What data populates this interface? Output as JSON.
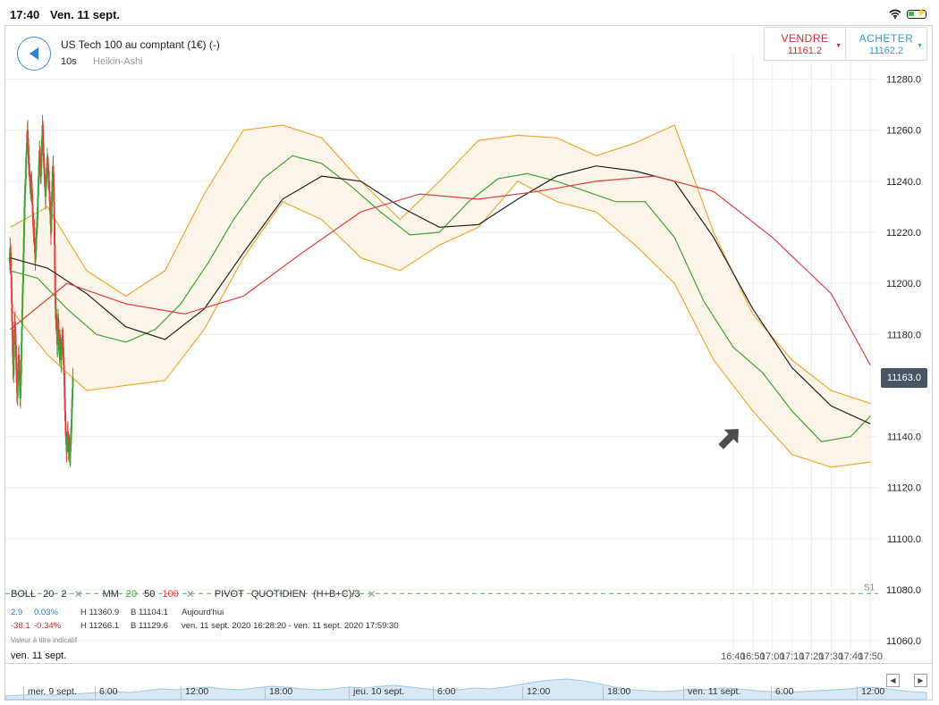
{
  "status_bar": {
    "time": "17:40",
    "date": "Ven. 11 sept."
  },
  "header": {
    "instrument": "US Tech 100 au comptant (1€) (-)",
    "interval": "10s",
    "chart_style": "Heikin-Ashi"
  },
  "trade": {
    "sell_label": "VENDRE",
    "sell_price": "11161.2",
    "buy_label": "ACHETER",
    "buy_price": "11162.2"
  },
  "current_price": "11163.0",
  "pivot_label": "S1",
  "legend": {
    "boll": "BOLL",
    "boll_period": "20",
    "boll_dev": "2",
    "ma": "MM",
    "ma1": "20",
    "ma2": "50",
    "ma3": "100",
    "pivot": "PIVOT",
    "pivot_period": "QUOTIDIEN",
    "pivot_formula": "(H+B+C)/3",
    "close": "✕"
  },
  "stats": {
    "row1": {
      "change": "2.9",
      "pct": "0.03%",
      "high": "H 11360.9",
      "low": "B 11104.1",
      "period": "Aujourd'hui"
    },
    "row2": {
      "change": "-38.1",
      "pct": "-0.34%",
      "high": "H 11266.1",
      "low": "B 11129.6",
      "period": "ven. 11 sept. 2020 16:28:20 - ven. 11 sept. 2020 17:59:30"
    }
  },
  "disclaimer": "Valeur à titre indicatif",
  "current_date": "ven. 11 sept.",
  "navigator": {
    "labels": [
      "mer. 9 sept.",
      "6:00",
      "12:00",
      "18:00",
      "jeu. 10 sept.",
      "6:00",
      "12:00",
      "18:00",
      "ven. 11 sept.",
      "6:00",
      "12:00"
    ]
  },
  "colors": {
    "accent": "#2a9fd8",
    "sell": "#d42b2b",
    "up": "#3fa535",
    "down": "#e04040",
    "bollinger": "#f0a830",
    "ma20": "#3fa535",
    "ma50": "#222222",
    "ma100": "#e04040",
    "pivot": "#5aa55a"
  },
  "chart_data": {
    "type": "line",
    "chart_style": "Heikin-Ashi",
    "y_ticks": [
      "11280.0",
      "11260.0",
      "11240.0",
      "11220.0",
      "11200.0",
      "11180.0",
      "11163.0",
      "11140.0",
      "11120.0",
      "11100.0",
      "11080.0",
      "11060.0"
    ],
    "ylim": [
      11052,
      11290
    ],
    "x_ticks": [
      "16:40",
      "16:50",
      "17:00",
      "17:10",
      "17:20",
      "17:30",
      "17:40",
      "17:50"
    ],
    "xlim_minutes": [
      628.5,
      1074.0
    ],
    "pivot_s1": 11078.5,
    "series": [
      {
        "name": "MM 20",
        "x": [
          631,
          645,
          660,
          675,
          690,
          705,
          718,
          732,
          745,
          760,
          775,
          790,
          805,
          820,
          835,
          850,
          865,
          880,
          895,
          910,
          925,
          940,
          955,
          970,
          985,
          1000,
          1015,
          1030,
          1045,
          1060,
          1070
        ],
        "values": [
          11205,
          11202,
          11190,
          11180,
          11177,
          11182,
          11192,
          11208,
          11225,
          11241,
          11250,
          11247,
          11238,
          11228,
          11219,
          11220,
          11232,
          11241,
          11243,
          11240,
          11236,
          11232,
          11232,
          11218,
          11193,
          11175,
          11165,
          11150,
          11138,
          11140,
          11148
        ]
      },
      {
        "name": "MM 50",
        "x": [
          631,
          650,
          670,
          690,
          710,
          730,
          750,
          770,
          790,
          810,
          830,
          850,
          870,
          890,
          910,
          930,
          950,
          970,
          990,
          1010,
          1030,
          1050,
          1070
        ],
        "values": [
          11210,
          11206,
          11196,
          11183,
          11178,
          11190,
          11212,
          11233,
          11242,
          11240,
          11230,
          11222,
          11223,
          11233,
          11242,
          11246,
          11244,
          11240,
          11218,
          11190,
          11167,
          11152,
          11145
        ]
      },
      {
        "name": "MM 100",
        "x": [
          631,
          660,
          690,
          720,
          750,
          780,
          810,
          840,
          870,
          900,
          930,
          960,
          990,
          1020,
          1050,
          1070
        ],
        "values": [
          11182,
          11200,
          11192,
          11188,
          11195,
          11212,
          11228,
          11235,
          11233,
          11236,
          11240,
          11242,
          11236,
          11218,
          11196,
          11168
        ]
      }
    ],
    "bollinger_upper": {
      "x": [
        631,
        650,
        670,
        690,
        710,
        730,
        750,
        770,
        790,
        810,
        830,
        850,
        870,
        890,
        910,
        930,
        950,
        970,
        990,
        1010,
        1030,
        1050,
        1070
      ],
      "values": [
        11222,
        11230,
        11205,
        11195,
        11205,
        11235,
        11260,
        11262,
        11257,
        11240,
        11225,
        11240,
        11256,
        11258,
        11257,
        11250,
        11255,
        11262,
        11220,
        11188,
        11170,
        11158,
        11153
      ]
    },
    "bollinger_lower": {
      "x": [
        631,
        650,
        670,
        690,
        710,
        730,
        750,
        770,
        790,
        810,
        830,
        850,
        870,
        890,
        910,
        930,
        950,
        970,
        990,
        1010,
        1030,
        1050,
        1070
      ],
      "values": [
        11190,
        11172,
        11158,
        11160,
        11162,
        11182,
        11210,
        11232,
        11225,
        11210,
        11205,
        11215,
        11222,
        11240,
        11232,
        11228,
        11215,
        11200,
        11170,
        11150,
        11133,
        11128,
        11130
      ]
    },
    "candles": {
      "start_minute": 630.6,
      "step_minutes": 0.1667,
      "closes": [
        11210,
        11208,
        11214,
        11212,
        11205,
        11203,
        11198,
        11192,
        11185,
        11178,
        11172,
        11168,
        11164,
        11170,
        11176,
        11182,
        11185,
        11183,
        11180,
        11176,
        11171,
        11166,
        11161,
        11158,
        11155,
        11160,
        11165,
        11168,
        11172,
        11170,
        11166,
        11162,
        11158,
        11155,
        11160,
        11164,
        11170,
        11177,
        11183,
        11190,
        11196,
        11200,
        11205,
        11212,
        11218,
        11224,
        11230,
        11235,
        11238,
        11241,
        11245,
        11249,
        11252,
        11255,
        11258,
        11260,
        11257,
        11254,
        11250,
        11247,
        11244,
        11243,
        11242,
        11240,
        11238,
        11236,
        11238,
        11240,
        11237,
        11234,
        11231,
        11228,
        11225,
        11222,
        11220,
        11222,
        11218,
        11215,
        11212,
        11210,
        11212,
        11215,
        11218,
        11220,
        11222,
        11226,
        11230,
        11234,
        11238,
        11242,
        11246,
        11249,
        11252,
        11250,
        11247,
        11244,
        11242,
        11246,
        11250,
        11254,
        11258,
        11262,
        11260,
        11255,
        11251,
        11248,
        11245,
        11243,
        11240,
        11237,
        11234,
        11236,
        11239,
        11242,
        11245,
        11247,
        11249,
        11247,
        11245,
        11242,
        11239,
        11240,
        11236,
        11233,
        11230,
        11227,
        11223,
        11220,
        11225,
        11230,
        11236,
        11240,
        11244,
        11246,
        11243,
        11238,
        11232,
        11225,
        11215,
        11205,
        11196,
        11190,
        11186,
        11188,
        11184,
        11180,
        11176,
        11180,
        11184,
        11186,
        11182,
        11178,
        11174,
        11172,
        11175,
        11178,
        11176,
        11173,
        11170,
        11172,
        11175,
        11178,
        11180,
        11178,
        11175,
        11171,
        11168,
        11165,
        11160,
        11155,
        11150,
        11146,
        11142,
        11140,
        11137,
        11135,
        11137,
        11140,
        11142,
        11139,
        11136,
        11134,
        11136,
        11138,
        11135,
        11132,
        11134,
        11137,
        11140,
        11143,
        11147,
        11151,
        11155,
        11159,
        11163
      ]
    }
  }
}
